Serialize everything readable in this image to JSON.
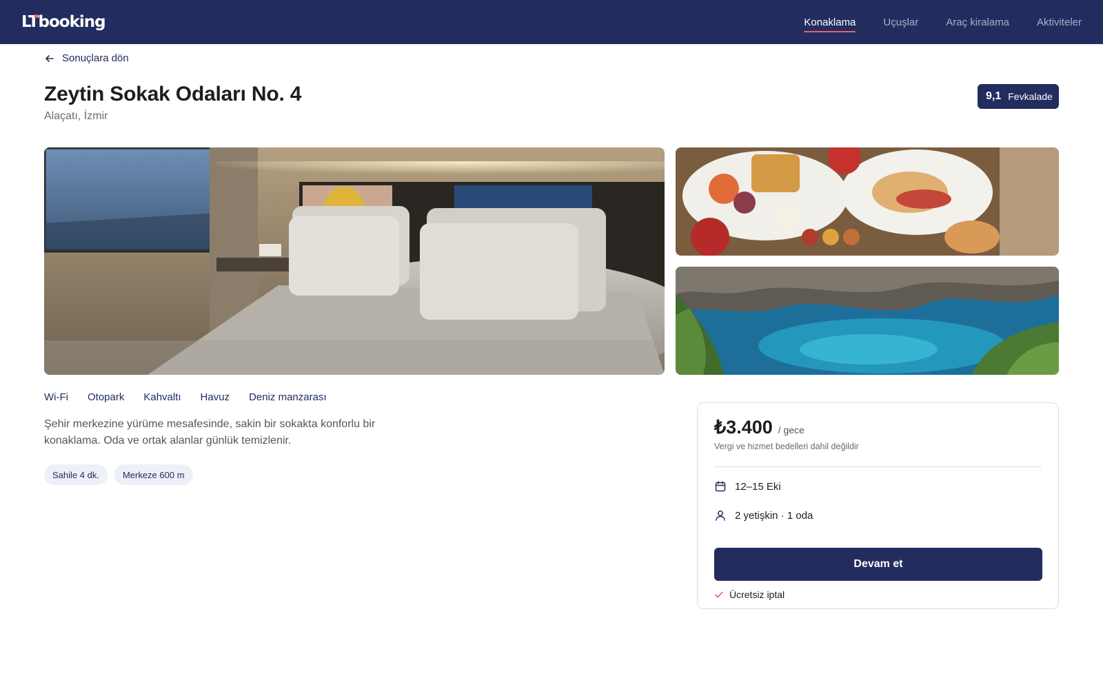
{
  "header": {
    "logo": "LTbooking",
    "nav": [
      {
        "label": "Konaklama",
        "active": true
      },
      {
        "label": "Uçuşlar",
        "active": false
      },
      {
        "label": "Araç kiralama",
        "active": false
      },
      {
        "label": "Aktiviteler",
        "active": false
      }
    ]
  },
  "back": {
    "label": "Sonuçlara dön",
    "icon": "arrow-left-icon"
  },
  "property": {
    "name": "Zeytin Sokak Odaları No. 4",
    "location": "Alaçatı, İzmir",
    "rating": {
      "score": "9,1",
      "label": "Fevkalade"
    }
  },
  "amenities": [
    "Wi-Fi",
    "Otopark",
    "Kahvaltı",
    "Havuz",
    "Deniz manzarası"
  ],
  "description": "Şehir merkezine yürüme mesafesinde, sakin bir sokakta konforlu bir konaklama. Oda ve ortak alanlar günlük temizlenir.",
  "chips": [
    "Sahile 4 dk.",
    "Merkeze 600 m"
  ],
  "booking": {
    "price": "₺3.400",
    "per_night": "/ gece",
    "tax_note": "Vergi ve hizmet bedelleri dahil değildir",
    "dates": "12–15 Eki",
    "guests": "2 yetişkin · 1 oda",
    "cta": "Devam et",
    "free_cancel": "Ücretsiz iptal"
  },
  "colors": {
    "brand": "#232c5e",
    "accent": "#e8616b"
  }
}
